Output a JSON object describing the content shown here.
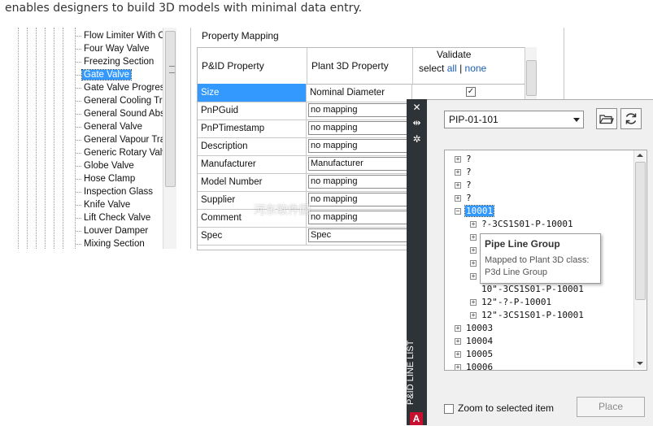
{
  "intro_text": "enables designers to build 3D models with minimal data entry.",
  "class_tree": {
    "items": [
      {
        "label": "Flow Limiter With Orif",
        "selected": false
      },
      {
        "label": "Four Way Valve",
        "selected": false
      },
      {
        "label": "Freezing Section",
        "selected": false
      },
      {
        "label": "Gate Valve",
        "selected": true
      },
      {
        "label": "Gate Valve Progressi",
        "selected": false
      },
      {
        "label": "General Cooling Trap",
        "selected": false
      },
      {
        "label": "General Sound Abso",
        "selected": false
      },
      {
        "label": "General Valve",
        "selected": false
      },
      {
        "label": "General Vapour Trap",
        "selected": false
      },
      {
        "label": "Generic Rotary Valve",
        "selected": false
      },
      {
        "label": "Globe Valve",
        "selected": false
      },
      {
        "label": "Hose Clamp",
        "selected": false
      },
      {
        "label": "Inspection Glass",
        "selected": false
      },
      {
        "label": "Knife Valve",
        "selected": false
      },
      {
        "label": "Lift Check Valve",
        "selected": false
      },
      {
        "label": "Louver Damper",
        "selected": false
      },
      {
        "label": "Mixing Section",
        "selected": false
      }
    ]
  },
  "property_mapping": {
    "title": "Property Mapping",
    "headers": {
      "pid_property": "P&ID Property",
      "plant3d_property": "Plant 3D Property",
      "validate": "Validate",
      "select_label": "select",
      "all_link": "all",
      "separator": "|",
      "none_link": "none"
    },
    "rows": [
      {
        "pid": "Size",
        "plant3d": "Nominal Diameter",
        "kind": "text",
        "validate": true,
        "selected": true
      },
      {
        "pid": "PnPGuid",
        "plant3d": "no mapping",
        "kind": "dropdown",
        "selected": false
      },
      {
        "pid": "PnPTimestamp",
        "plant3d": "no mapping",
        "kind": "dropdown",
        "selected": false
      },
      {
        "pid": "Description",
        "plant3d": "no mapping",
        "kind": "dropdown",
        "selected": false
      },
      {
        "pid": "Manufacturer",
        "plant3d": "Manufacturer",
        "kind": "dropdown",
        "selected": false
      },
      {
        "pid": "Model Number",
        "plant3d": "no mapping",
        "kind": "dropdown",
        "selected": false
      },
      {
        "pid": "Supplier",
        "plant3d": "no mapping",
        "kind": "dropdown",
        "selected": false
      },
      {
        "pid": "Comment",
        "plant3d": "no mapping",
        "kind": "dropdown",
        "selected": false
      },
      {
        "pid": "Spec",
        "plant3d": "Spec",
        "kind": "dropdown",
        "selected": false
      }
    ]
  },
  "line_list": {
    "title": "P&ID LINE LIST",
    "drawing": "PIP-01-101",
    "tree": [
      {
        "label": "?",
        "indent": 0,
        "expander": "+"
      },
      {
        "label": "?",
        "indent": 0,
        "expander": "+"
      },
      {
        "label": "?",
        "indent": 0,
        "expander": "+"
      },
      {
        "label": "?",
        "indent": 0,
        "expander": "+"
      },
      {
        "label": "10001",
        "indent": 0,
        "expander": "-",
        "selected": true
      },
      {
        "label": "?-3CS1S01-P-10001",
        "indent": 1,
        "expander": "+"
      },
      {
        "label": "",
        "indent": 1,
        "expander": "+"
      },
      {
        "label": "",
        "indent": 1,
        "expander": "+"
      },
      {
        "label": "",
        "indent": 1,
        "expander": "+"
      },
      {
        "label": "",
        "indent": 1,
        "expander": "+"
      },
      {
        "label": "10\"-3CS1S01-P-10001",
        "indent": 1,
        "expander": ""
      },
      {
        "label": "12\"-?-P-10001",
        "indent": 1,
        "expander": "+"
      },
      {
        "label": "12\"-3CS1S01-P-10001",
        "indent": 1,
        "expander": "+"
      },
      {
        "label": "10003",
        "indent": 0,
        "expander": "+"
      },
      {
        "label": "10004",
        "indent": 0,
        "expander": "+"
      },
      {
        "label": "10005",
        "indent": 0,
        "expander": "+"
      },
      {
        "label": "10006",
        "indent": 0,
        "expander": "+"
      }
    ],
    "tooltip": {
      "title": "Pipe Line Group",
      "line1": "Mapped to Plant 3D class:",
      "line2": "P3d Line Group"
    },
    "zoom_label": "Zoom to selected item",
    "place_label": "Place",
    "logo_letter": "A"
  },
  "watermark": "河东软件园"
}
